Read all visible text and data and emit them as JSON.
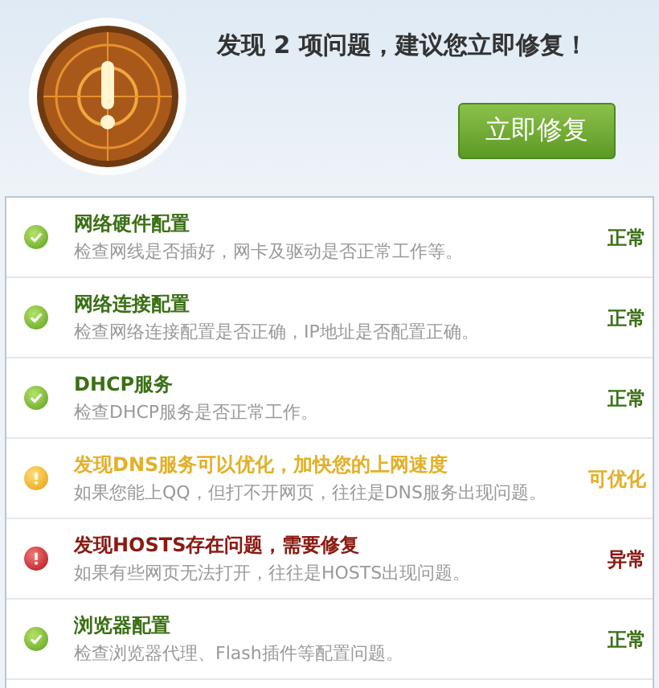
{
  "header": {
    "message": "发现 2 项问题，建议您立即修复！",
    "fix_button": "立即修复"
  },
  "checks": [
    {
      "kind": "ok",
      "title": "网络硬件配置",
      "description": "检查网线是否插好，网卡及驱动是否正常工作等。",
      "status": "正常"
    },
    {
      "kind": "ok",
      "title": "网络连接配置",
      "description": "检查网络连接配置是否正确，IP地址是否配置正确。",
      "status": "正常"
    },
    {
      "kind": "ok",
      "title": "DHCP服务",
      "description": "检查DHCP服务是否正常工作。",
      "status": "正常"
    },
    {
      "kind": "warning",
      "title": "发现DNS服务可以优化，加快您的上网速度",
      "description": "如果您能上QQ，但打不开网页，往往是DNS服务出现问题。",
      "status": "可优化"
    },
    {
      "kind": "error",
      "title": "发现HOSTS存在问题，需要修复",
      "description": "如果有些网页无法打开，往往是HOSTS出现问题。",
      "status": "异常"
    },
    {
      "kind": "ok",
      "title": "浏览器配置",
      "description": "检查浏览器代理、Flash插件等配置问题。",
      "status": "正常"
    }
  ]
}
